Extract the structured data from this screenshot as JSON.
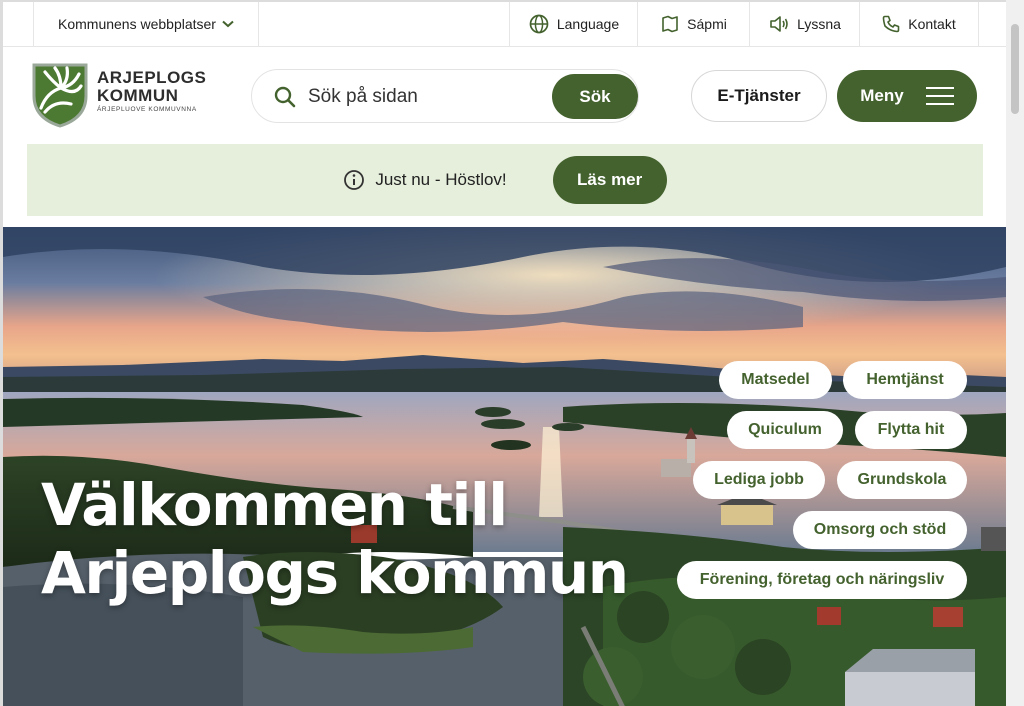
{
  "topbar": {
    "sites_label": "Kommunens webbplatser",
    "language_label": "Language",
    "sapmi_label": "Sápmi",
    "listen_label": "Lyssna",
    "contact_label": "Kontakt"
  },
  "header": {
    "logo_line1": "ARJEPLOGS",
    "logo_line2": "KOMMUN",
    "logo_line3": "ÁRJEPLUOVE KOMMUVNNA",
    "search_placeholder": "Sök på sidan",
    "search_button": "Sök",
    "etjanster_label": "E-Tjänster",
    "menu_label": "Meny"
  },
  "notice": {
    "text": "Just nu - Höstlov!",
    "button": "Läs mer"
  },
  "hero": {
    "title_line1": "Välkommen till",
    "title_line2": "Arjeplogs kommun"
  },
  "quicklinks": [
    "Matsedel",
    "Hemtjänst",
    "Quiculum",
    "Flytta hit",
    "Lediga jobb",
    "Grundskola",
    "Omsorg och stöd",
    "Förening, företag och näringsliv"
  ],
  "colors": {
    "brand_green": "#44622e",
    "notice_bg": "#e6efdc"
  }
}
